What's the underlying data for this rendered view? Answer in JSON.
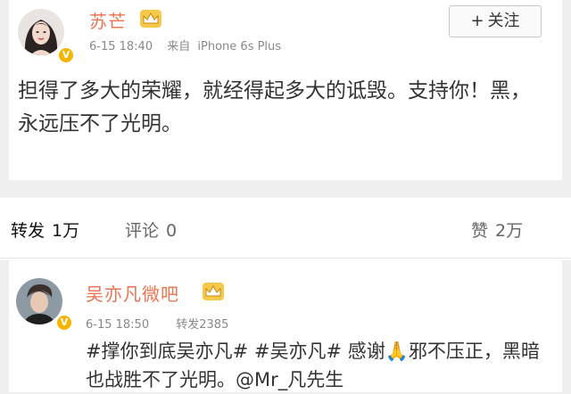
{
  "post": {
    "author": "苏芒",
    "date": "6-15 18:40",
    "source_prefix": "来自",
    "source": "iPhone 6s Plus",
    "follow_label": "关注",
    "follow_plus": "+",
    "content": "担得了多大的荣耀，就经得起多大的诋毁。支持你！黑，永远压不了光明。"
  },
  "tabs": {
    "repost_label": "转发",
    "repost_count": "1万",
    "comment_label": "评论",
    "comment_count": "0",
    "like_label": "赞",
    "like_count": "2万"
  },
  "repost": {
    "author": "吴亦凡微吧",
    "date": "6-15 18:50",
    "repost_count_text": "转发2385",
    "text_tag1": "#撑你到底吴亦凡#",
    "text_tag2": "#吴亦凡#",
    "text_body": "感谢🙏邪不压正，黑暗也战胜不了光明。@Mr_凡先生"
  },
  "colors": {
    "name": "#eb7350",
    "badge": "#f4b400",
    "meta": "#888888"
  },
  "icons": {
    "verified": "verified-badge-icon",
    "crown": "crown-member-icon"
  }
}
